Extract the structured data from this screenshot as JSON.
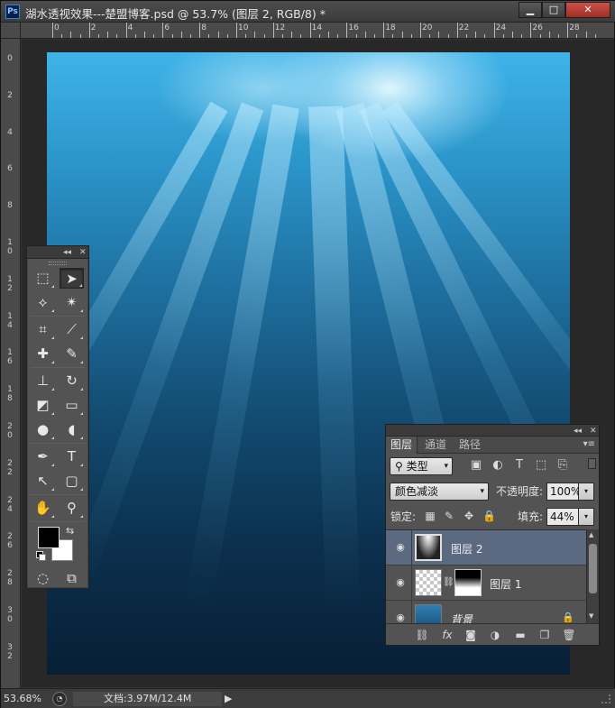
{
  "window": {
    "app_icon": "Ps",
    "title": "湖水透视效果---楚盟博客.psd @ 53.7% (图层 2, RGB/8) *",
    "minimize": "▁",
    "maximize": "□",
    "close": "✕"
  },
  "rulers": {
    "top_labels": [
      "0",
      "2",
      "4",
      "6",
      "8",
      "10",
      "12",
      "14",
      "16",
      "18",
      "20",
      "22",
      "24",
      "26",
      "28"
    ],
    "left_labels": [
      "0",
      "2",
      "4",
      "6",
      "8",
      "1\n0",
      "1\n2",
      "1\n4",
      "1\n6",
      "1\n8",
      "2\n0",
      "2\n2",
      "2\n4",
      "2\n6",
      "2\n8",
      "3\n0",
      "3\n2"
    ]
  },
  "tools_panel": {
    "collapse": "◂◂",
    "close": "✕",
    "tools": [
      {
        "name": "rectangular-marquee-tool",
        "icon": "⬚"
      },
      {
        "name": "move-tool",
        "icon": "➤"
      },
      {
        "name": "polygonal-lasso-tool",
        "icon": "⟡"
      },
      {
        "name": "magic-wand-tool",
        "icon": "✴"
      },
      {
        "name": "crop-tool",
        "icon": "⌗"
      },
      {
        "name": "eyedropper-tool",
        "icon": "⟋"
      },
      {
        "name": "spot-healing-brush-tool",
        "icon": "✚"
      },
      {
        "name": "brush-tool",
        "icon": "✎"
      },
      {
        "name": "clone-stamp-tool",
        "icon": "⊥"
      },
      {
        "name": "history-brush-tool",
        "icon": "↻"
      },
      {
        "name": "eraser-tool",
        "icon": "◩"
      },
      {
        "name": "gradient-tool",
        "icon": "▭"
      },
      {
        "name": "blur-tool",
        "icon": "●"
      },
      {
        "name": "dodge-tool",
        "icon": "◖"
      },
      {
        "name": "pen-tool",
        "icon": "✒"
      },
      {
        "name": "type-tool",
        "icon": "T"
      },
      {
        "name": "path-selection-tool",
        "icon": "↖"
      },
      {
        "name": "rectangle-shape-tool",
        "icon": "▢"
      },
      {
        "name": "hand-tool",
        "icon": "✋"
      },
      {
        "name": "zoom-tool",
        "icon": "⚲"
      }
    ],
    "swap_icon": "⇆",
    "quick_mask_icon": "◌",
    "screen_mode_icon": "⧉"
  },
  "layers_panel": {
    "collapse": "◂◂",
    "close": "✕",
    "tabs": [
      "图层",
      "通道",
      "路径"
    ],
    "menu_icon": "▾≡",
    "filter_label": "类型",
    "filter_search_icon": "⚲",
    "blend_mode": "颜色减淡",
    "opacity_label": "不透明度:",
    "opacity_value": "100%",
    "lock_label": "锁定:",
    "fill_label": "填充:",
    "fill_value": "44%",
    "dropdown_arrow": "▾",
    "layers": [
      {
        "name": "图层 2"
      },
      {
        "name": "图层 1"
      },
      {
        "name": "背景"
      }
    ]
  },
  "status": {
    "zoom": "53.68%",
    "doc_info": "文档:3.97M/12.4M",
    "arrow": "▶"
  },
  "colors": {
    "foreground": "#000000",
    "background": "#ffffff",
    "selected_layer": "#5b6a80"
  }
}
